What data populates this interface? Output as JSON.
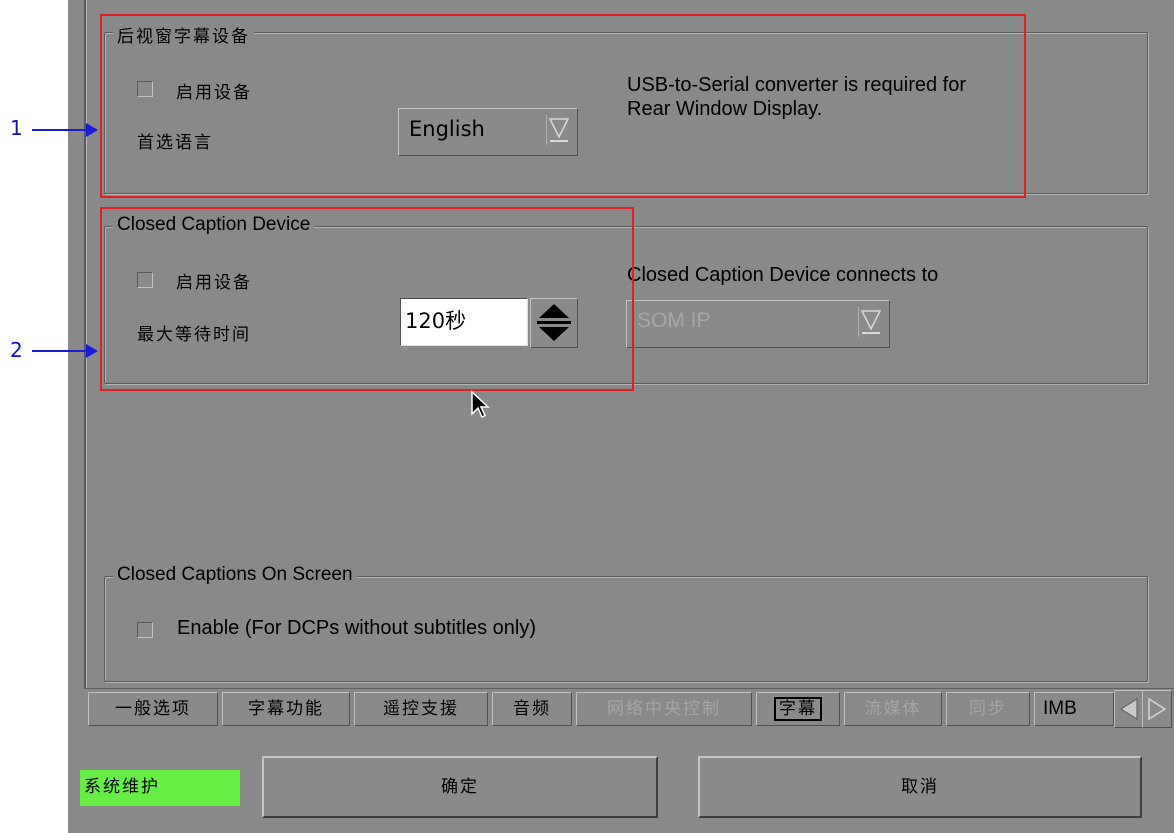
{
  "callouts": {
    "one": "1",
    "two": "2"
  },
  "rear_window": {
    "legend": "后视窗字幕设备",
    "enable_label": "启用设备",
    "language_label": "首选语言",
    "language_value": "English",
    "note": "USB-to-Serial converter is required for Rear Window Display."
  },
  "cc_device": {
    "legend": "Closed Caption Device",
    "enable_label": "启用设备",
    "wait_label": "最大等待时间",
    "wait_value": "120秒",
    "connects_label": "Closed Caption Device connects to",
    "connects_value": "SOM IP"
  },
  "on_screen": {
    "legend": "Closed Captions On Screen",
    "enable_label": "Enable (For DCPs without subtitles only)"
  },
  "tabs": [
    {
      "label": "一般选项",
      "state": "normal"
    },
    {
      "label": "字幕功能",
      "state": "normal"
    },
    {
      "label": "遥控支援",
      "state": "normal"
    },
    {
      "label": "音频",
      "state": "normal"
    },
    {
      "label": "网络中央控制",
      "state": "disabled"
    },
    {
      "label": "字幕",
      "state": "active"
    },
    {
      "label": "流媒体",
      "state": "disabled"
    },
    {
      "label": "同步",
      "state": "disabled"
    },
    {
      "label": "IMB",
      "state": "normal"
    }
  ],
  "footer": {
    "status": "系统维护",
    "ok": "确定",
    "cancel": "取消"
  },
  "colors": {
    "panel": "#898989",
    "highlight_box": "#e02020",
    "callout": "#1a1adc",
    "status_bg": "#66ee44"
  }
}
